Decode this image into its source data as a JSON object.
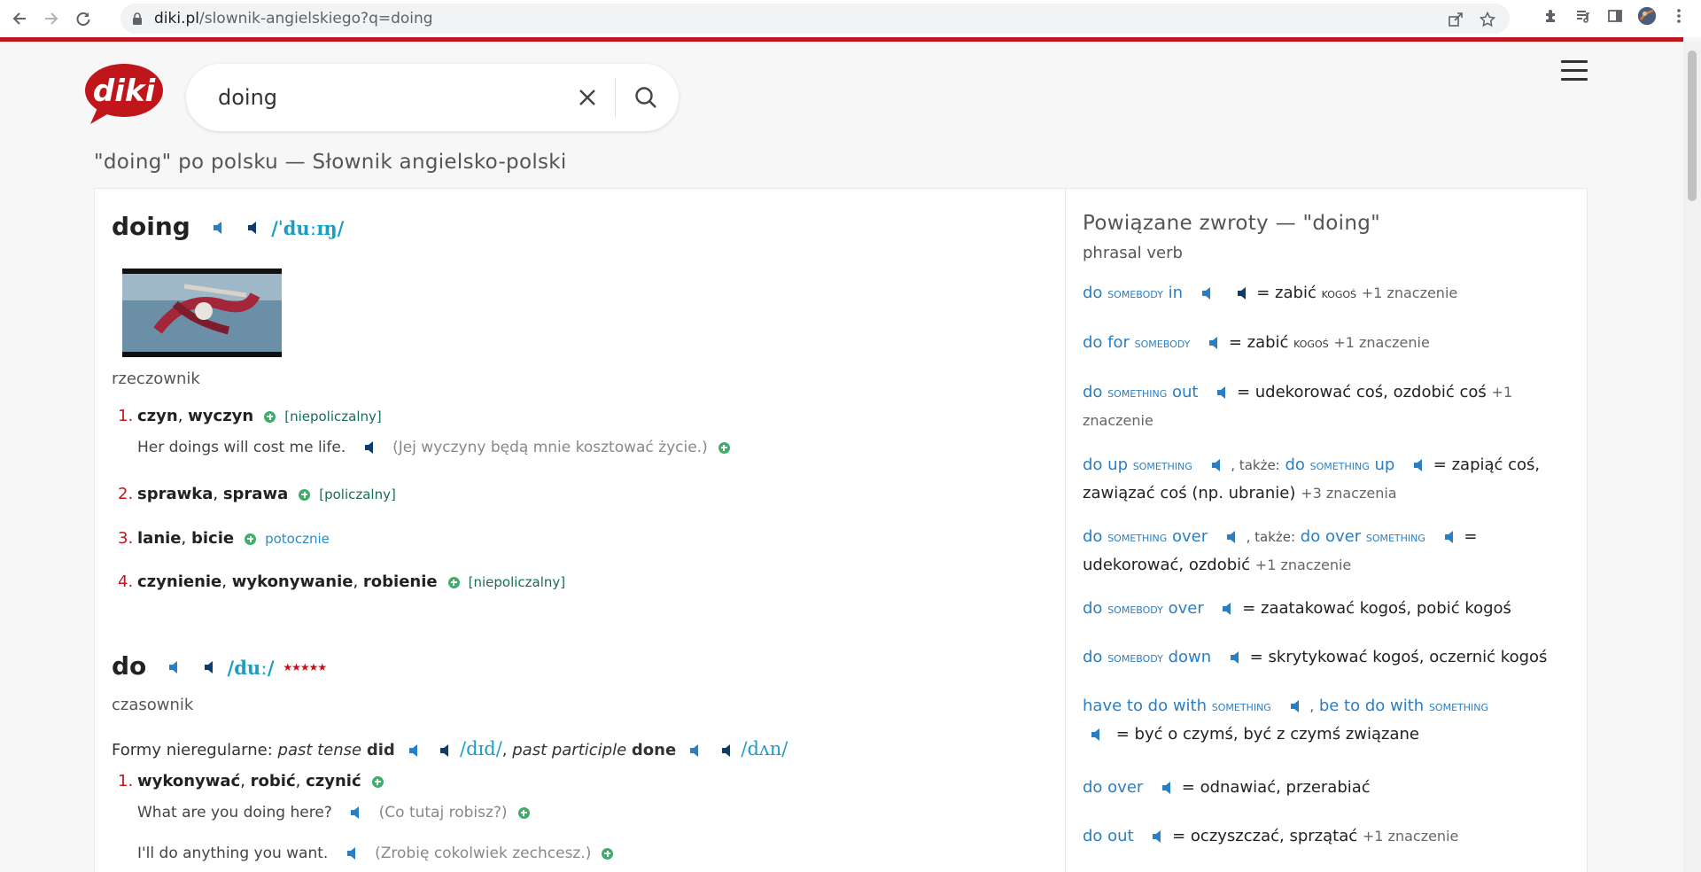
{
  "browser": {
    "url_host": "diki.pl",
    "url_path": "/slownik-angielskiego?q=doing"
  },
  "search": {
    "query": "doing"
  },
  "page_heading": "\"doing\" po polsku — Słownik angielsko-polski",
  "colors": {
    "brand_red": "#c0161b",
    "link_blue": "#2a7fc4",
    "pron_teal": "#1c9dc4",
    "plus_green": "#3fae6b"
  },
  "entries": [
    {
      "headword": "doing",
      "pron": "/ˈduːɪŋ/",
      "pos": "rzeczownik",
      "meanings": [
        {
          "num": "1.",
          "words": [
            "czyn",
            "wyczyn"
          ],
          "tag": "[niepoliczalny]",
          "example": "Her doings will cost me life.",
          "translation": "(Jej wyczyny będą mnie kosztować życie.)"
        },
        {
          "num": "2.",
          "words": [
            "sprawka",
            "sprawa"
          ],
          "tag": "[policzalny]"
        },
        {
          "num": "3.",
          "words": [
            "lanie",
            "bicie"
          ],
          "tag": "potocznie"
        },
        {
          "num": "4.",
          "words": [
            "czynienie",
            "wykonywanie",
            "robienie"
          ],
          "tag": "[niepoliczalny]"
        }
      ]
    },
    {
      "headword": "do",
      "pron": "/duː/",
      "stars": "★★★★★",
      "pos": "czasownik",
      "irregular": {
        "label": "Formy nieregularne:",
        "past_tense_label": "past tense",
        "past_tense": "did",
        "past_tense_pron": "/dɪd/",
        "past_participle_label": "past participle",
        "past_participle": "done",
        "past_participle_pron": "/dʌn/"
      },
      "meanings": [
        {
          "num": "1.",
          "words": [
            "wykonywać",
            "robić",
            "czynić"
          ],
          "examples": [
            {
              "en": "What are you doing here?",
              "pl": "(Co tutaj robisz?)"
            },
            {
              "en": "I'll do anything you want.",
              "pl": "(Zrobię cokolwiek zechcesz.)"
            }
          ]
        }
      ]
    }
  ],
  "related": {
    "title": "Powiązane zwroty — \"doing\"",
    "subtitle": "phrasal verb",
    "also_label": ", także:",
    "items": [
      {
        "a": "do",
        "b": "somebody",
        "c": "in",
        "pl1": "= zabić",
        "pl2": "kogoś",
        "more": "+1 znaczenie"
      },
      {
        "a": "do for",
        "b": "somebody",
        "pl1": "= zabić",
        "pl2": "kogoś",
        "more": "+1 znaczenie"
      },
      {
        "a": "do",
        "b": "something",
        "c": "out",
        "pl": "= udekorować coś, ozdobić coś",
        "more": "+1 znaczenie"
      },
      {
        "a": "do up",
        "b": "something",
        "alt_a": "do",
        "alt_b": "something",
        "alt_c": "up",
        "pl": "= zapiąć coś, zawiązać coś (np. ubranie)",
        "more": "+3 znaczenia"
      },
      {
        "a": "do",
        "b": "something",
        "c": "over",
        "alt_a": "do over",
        "alt_b": "something",
        "pl": "= udekorować, ozdobić",
        "more": "+1 znaczenie"
      },
      {
        "a": "do",
        "b": "somebody",
        "c": "over",
        "pl": "= zaatakować kogoś, pobić kogoś"
      },
      {
        "a": "do",
        "b": "somebody",
        "c": "down",
        "pl": "= skrytykować kogoś, oczernić kogoś"
      },
      {
        "a": "have to do with",
        "b": "something",
        "alt_a": "be to do with",
        "alt_b": "something",
        "pl": "= być o czymś, być z czymś związane"
      },
      {
        "a": "do over",
        "pl": "= odnawiać, przerabiać"
      },
      {
        "a": "do out",
        "pl": "= oczyszczać, sprzątać",
        "more": "+1 znaczenie"
      }
    ]
  }
}
